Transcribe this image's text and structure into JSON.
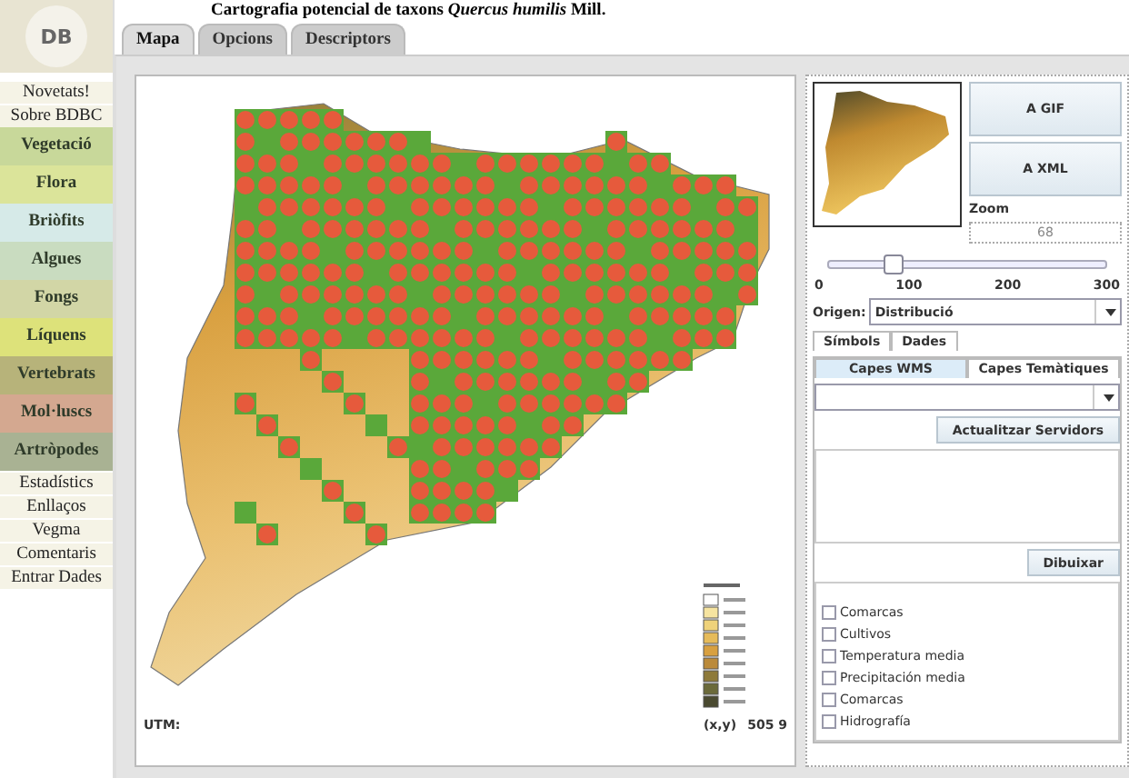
{
  "logo": {
    "text": "DB"
  },
  "sidebar": {
    "items": [
      {
        "label": "Novetats!",
        "kind": "link"
      },
      {
        "label": "Sobre BDBC",
        "kind": "link"
      },
      {
        "label": "Vegetació",
        "kind": "category",
        "color": "#c8d89a"
      },
      {
        "label": "Flora",
        "kind": "category",
        "color": "#dbe49a"
      },
      {
        "label": "Briòfits",
        "kind": "category",
        "color": "#d6eae8"
      },
      {
        "label": "Algues",
        "kind": "category",
        "color": "#c9dcc0"
      },
      {
        "label": "Fongs",
        "kind": "category",
        "color": "#d2d6a6"
      },
      {
        "label": "Líquens",
        "kind": "category",
        "color": "#dde27a"
      },
      {
        "label": "Vertebrats",
        "kind": "category",
        "color": "#b7b37a"
      },
      {
        "label": "Mol·luscs",
        "kind": "category",
        "color": "#d4a890"
      },
      {
        "label": "Artròpodes",
        "kind": "category",
        "color": "#a9b293"
      },
      {
        "label": "Estadístics",
        "kind": "link"
      },
      {
        "label": "Enllaços",
        "kind": "link"
      },
      {
        "label": "Vegma",
        "kind": "link"
      },
      {
        "label": "Comentaris",
        "kind": "link"
      },
      {
        "label": "Entrar Dades",
        "kind": "link"
      }
    ]
  },
  "title": "Cartografia potencial de taxons *Quercus humilis* Mill.",
  "tabs": [
    {
      "label": "Mapa",
      "selected": true
    },
    {
      "label": "Opcions",
      "selected": false
    },
    {
      "label": "Descriptors",
      "selected": false
    }
  ],
  "map": {
    "status_left": "UTM:",
    "coords_label": "(x,y)",
    "coords_value": "505 9"
  },
  "panel": {
    "buttons": [
      "A GIF",
      "A XML"
    ],
    "zoom": {
      "label": "Zoom",
      "value": "68",
      "level": 0.227,
      "ticks": [
        "0",
        "100",
        "200",
        "300"
      ]
    },
    "origin": {
      "label": "Origen:",
      "value": "Distribució"
    },
    "tabs": [
      {
        "label": "Símbols",
        "selected": false
      },
      {
        "label": "Dades",
        "selected": false
      }
    ],
    "layer_tabs": [
      {
        "label": "Capes WMS",
        "selected": true
      },
      {
        "label": "Capes Temàtiques",
        "selected": false
      }
    ],
    "refresh_button": "Actualitzar Servidors",
    "draw_button": "Dibuixar",
    "layers": [
      {
        "label": "Comarcas",
        "checked": false
      },
      {
        "label": "Cultivos",
        "checked": false
      },
      {
        "label": "Temperatura media",
        "checked": false
      },
      {
        "label": "Precipitación media",
        "checked": false
      },
      {
        "label": "Comarcas",
        "checked": false
      },
      {
        "label": "Hidrografía",
        "checked": false
      }
    ]
  }
}
